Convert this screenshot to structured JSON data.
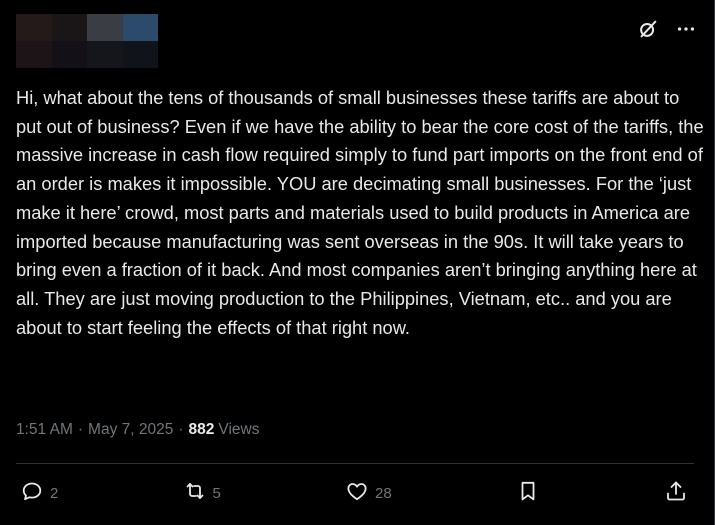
{
  "post": {
    "text": "Hi, what about the tens of thousands of small businesses these tariffs are about to put out of business? Even if we have the ability to bear the core cost of the tariffs, the massive increase in cash flow required simply to fund part imports on the front end of an order is makes it impossible. YOU are decimating small businesses. For the ‘just make it here’ crowd, most parts and materials used to build products in America are imported because manufacturing was sent overseas in the 90s. It will take years to bring even a fraction of it back. And most companies aren’t bringing anything here at all. They are just moving production to the Philippines, Vietnam, etc.. and you are about to start feeling the effects of that right now.",
    "time": "1:51 AM",
    "date": "May 7, 2025",
    "separator": "·",
    "views_count": "882",
    "views_label": "Views"
  },
  "header": {
    "grok_icon": "grok-icon",
    "more_icon": "more-icon"
  },
  "actions": {
    "reply_count": "2",
    "repost_count": "5",
    "like_count": "28"
  },
  "colors": {
    "background": "#000000",
    "text": "#e7e9ea",
    "muted": "#71767b",
    "border": "#2f3336"
  }
}
